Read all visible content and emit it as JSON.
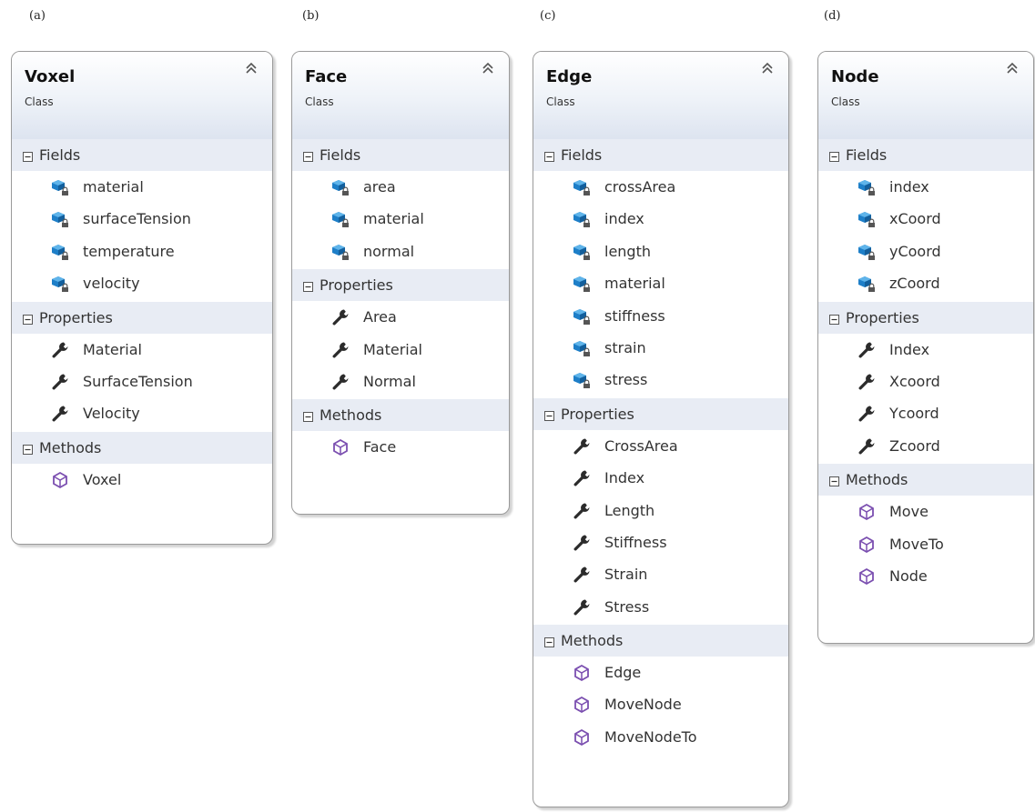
{
  "panels": [
    {
      "panel_label": "(a)",
      "title": "Voxel",
      "subtitle": "Class",
      "sections": [
        {
          "label": "Fields",
          "kind": "field",
          "items": [
            "material",
            "surfaceTension",
            "temperature",
            "velocity"
          ]
        },
        {
          "label": "Properties",
          "kind": "property",
          "items": [
            "Material",
            "SurfaceTension",
            "Velocity"
          ]
        },
        {
          "label": "Methods",
          "kind": "method",
          "items": [
            "Voxel"
          ]
        }
      ]
    },
    {
      "panel_label": "(b)",
      "title": "Face",
      "subtitle": "Class",
      "sections": [
        {
          "label": "Fields",
          "kind": "field",
          "items": [
            "area",
            "material",
            "normal"
          ]
        },
        {
          "label": "Properties",
          "kind": "property",
          "items": [
            "Area",
            "Material",
            "Normal"
          ]
        },
        {
          "label": "Methods",
          "kind": "method",
          "items": [
            "Face"
          ]
        }
      ]
    },
    {
      "panel_label": "(c)",
      "title": "Edge",
      "subtitle": "Class",
      "sections": [
        {
          "label": "Fields",
          "kind": "field",
          "items": [
            "crossArea",
            "index",
            "length",
            "material",
            "stiffness",
            "strain",
            "stress"
          ]
        },
        {
          "label": "Properties",
          "kind": "property",
          "items": [
            "CrossArea",
            "Index",
            "Length",
            "Stiffness",
            "Strain",
            "Stress"
          ]
        },
        {
          "label": "Methods",
          "kind": "method",
          "items": [
            "Edge",
            "MoveNode",
            "MoveNodeTo"
          ]
        }
      ]
    },
    {
      "panel_label": "(d)",
      "title": "Node",
      "subtitle": "Class",
      "sections": [
        {
          "label": "Fields",
          "kind": "field",
          "items": [
            "index",
            "xCoord",
            "yCoord",
            "zCoord"
          ]
        },
        {
          "label": "Properties",
          "kind": "property",
          "items": [
            "Index",
            "Xcoord",
            "Ycoord",
            "Zcoord"
          ]
        },
        {
          "label": "Methods",
          "kind": "method",
          "items": [
            "Move",
            "MoveTo",
            "Node"
          ]
        }
      ]
    }
  ],
  "icons": {
    "field": "field-icon",
    "property": "property-wrench-icon",
    "method": "method-cube-icon",
    "collapse": "collapse-chevrons-icon",
    "section_toggle": "minus-box-icon"
  },
  "colors": {
    "field_icon": "#1e7fc8",
    "method_icon": "#7b4fb0",
    "header_gradient_end": "#dde4f0",
    "section_band": "#e8ecf4"
  }
}
